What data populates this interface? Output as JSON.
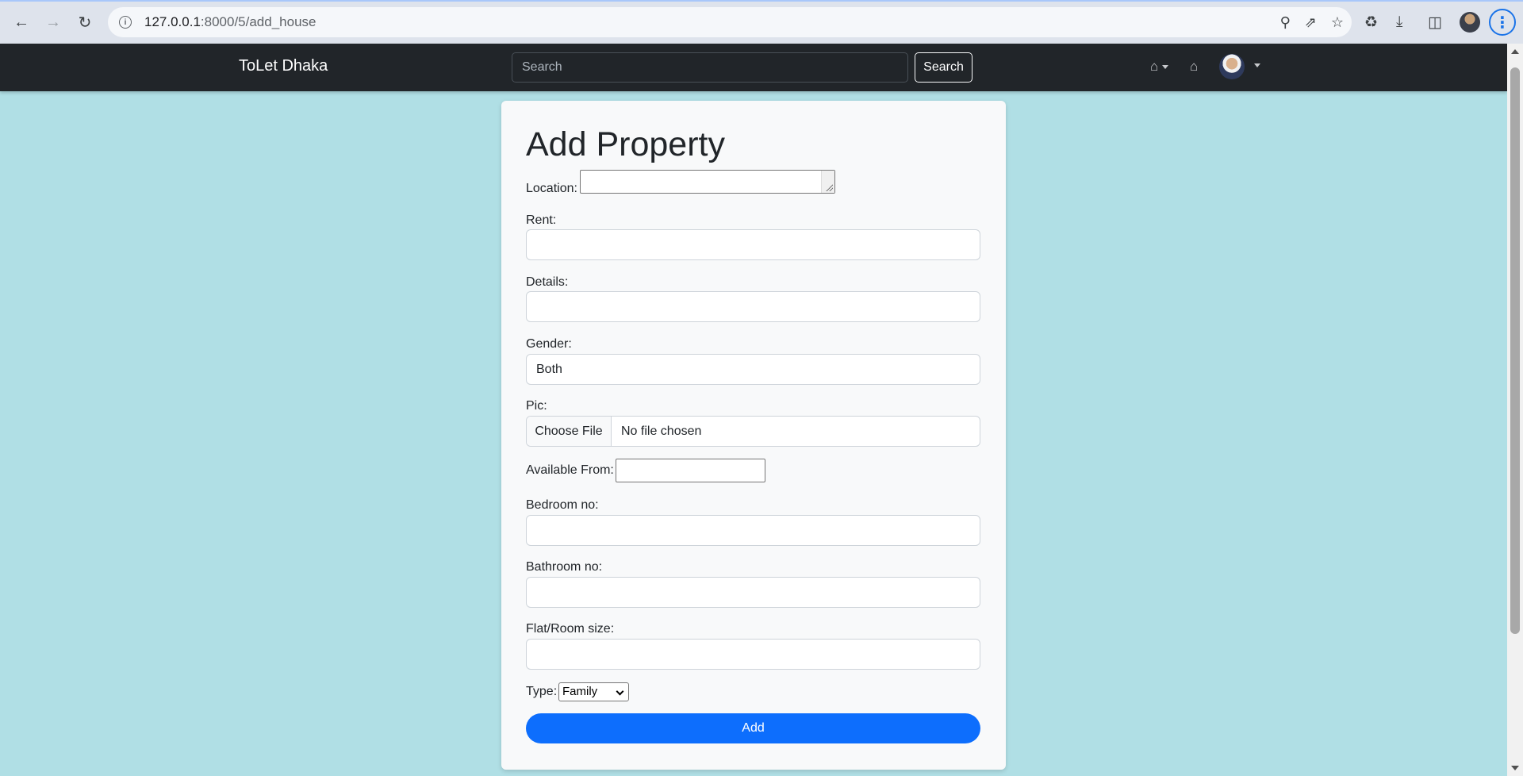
{
  "browser": {
    "url_host": "127.0.0.1",
    "url_path": ":8000/5/add_house",
    "icons": [
      "back-icon",
      "forward-icon",
      "reload-icon",
      "info-icon",
      "zoom-icon",
      "share-icon",
      "star-icon",
      "extensions-icon",
      "download-icon",
      "sidepanel-icon",
      "profile-avatar",
      "menu-icon"
    ]
  },
  "navbar": {
    "brand": "ToLet Dhaka",
    "search_placeholder": "Search",
    "search_button": "Search"
  },
  "form": {
    "title": "Add Property",
    "location_label": "Location:",
    "rent_label": "Rent:",
    "details_label": "Details:",
    "gender_label": "Gender:",
    "gender_value": "Both",
    "pic_label": "Pic:",
    "file_button": "Choose File",
    "file_status": "No file chosen",
    "available_label": "Available From:",
    "bedroom_label": "Bedroom no:",
    "bathroom_label": "Bathroom no:",
    "size_label": "Flat/Room size:",
    "type_label": "Type:",
    "type_value": "Family",
    "submit": "Add"
  },
  "colors": {
    "page_bg": "#b0dfe5",
    "navbar_bg": "#212529",
    "primary": "#0d6efd",
    "card_bg": "#f8f9fa"
  }
}
